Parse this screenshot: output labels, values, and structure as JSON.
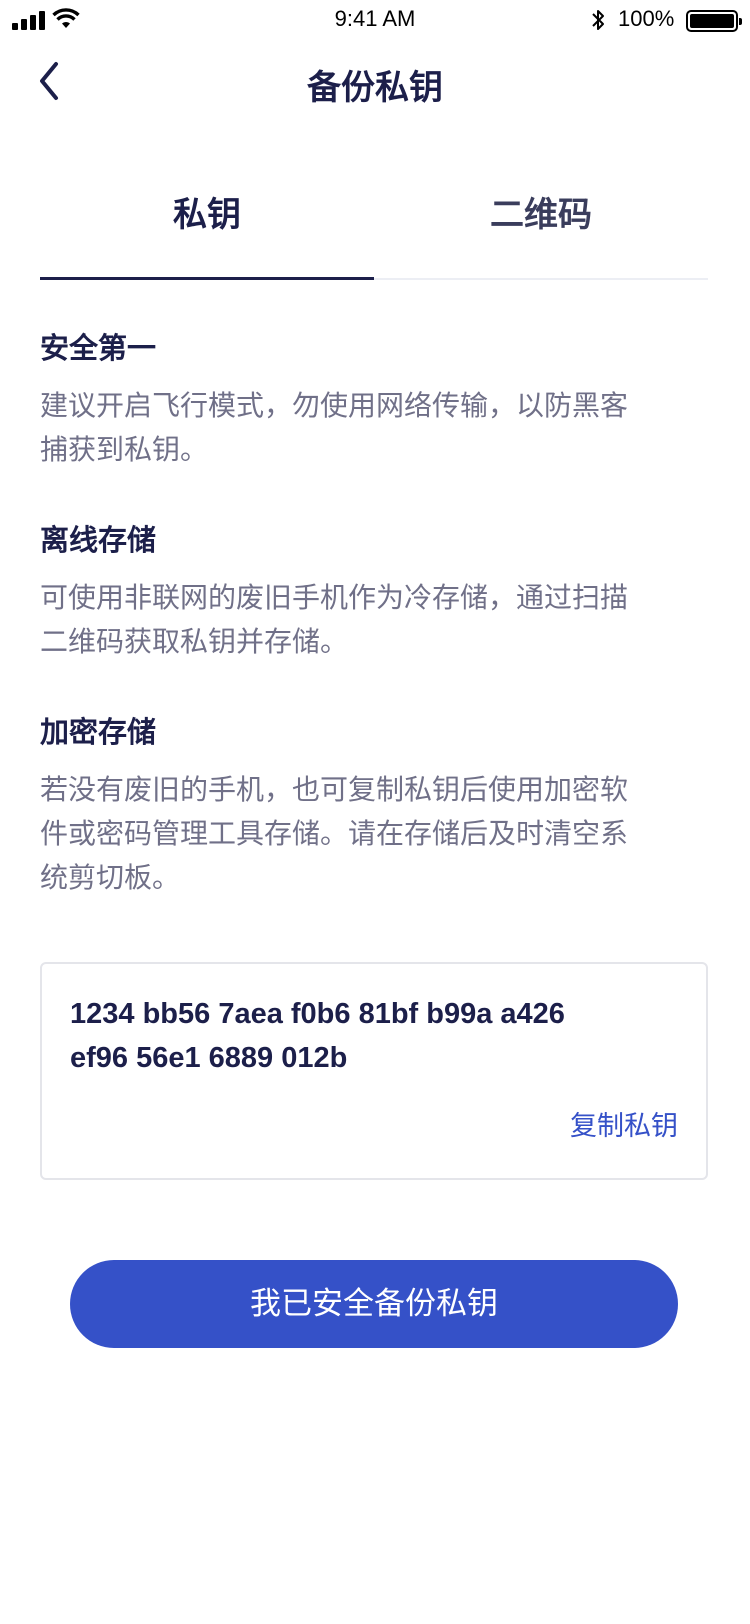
{
  "status_bar": {
    "time": "9:41 AM",
    "battery_percent": "100%",
    "icons": [
      "signal-icon",
      "wifi-icon",
      "bluetooth-icon",
      "battery-icon"
    ]
  },
  "nav": {
    "back_icon": "chevron-left-icon",
    "title": "备份私钥"
  },
  "tabs": [
    {
      "label": "私钥",
      "active": true
    },
    {
      "label": "二维码",
      "active": false
    }
  ],
  "sections": [
    {
      "title": "安全第一",
      "lines": [
        "建议开启飞行模式，勿使用网络传输，以防黑客",
        "捕获到私钥。"
      ]
    },
    {
      "title": "离线存储",
      "lines": [
        "可使用非联网的废旧手机作为冷存储，通过扫描",
        "二维码获取私钥并存储。"
      ]
    },
    {
      "title": "加密存储",
      "lines": [
        "若没有废旧的手机，也可复制私钥后使用加密软",
        "件或密码管理工具存储。请在存储后及时清空系",
        "统剪切板。"
      ]
    }
  ],
  "private_key": {
    "lines": [
      "1234 bb56 7aea f0b6 81bf b99a a426",
      "ef96 56e1 6889 012b"
    ],
    "copy_label": "复制私钥"
  },
  "primary_button": {
    "label": "我已安全备份私钥"
  },
  "colors": {
    "accent": "#3551c8",
    "title": "#1c1f4a",
    "body_text": "#707088",
    "divider": "#eceef4"
  }
}
